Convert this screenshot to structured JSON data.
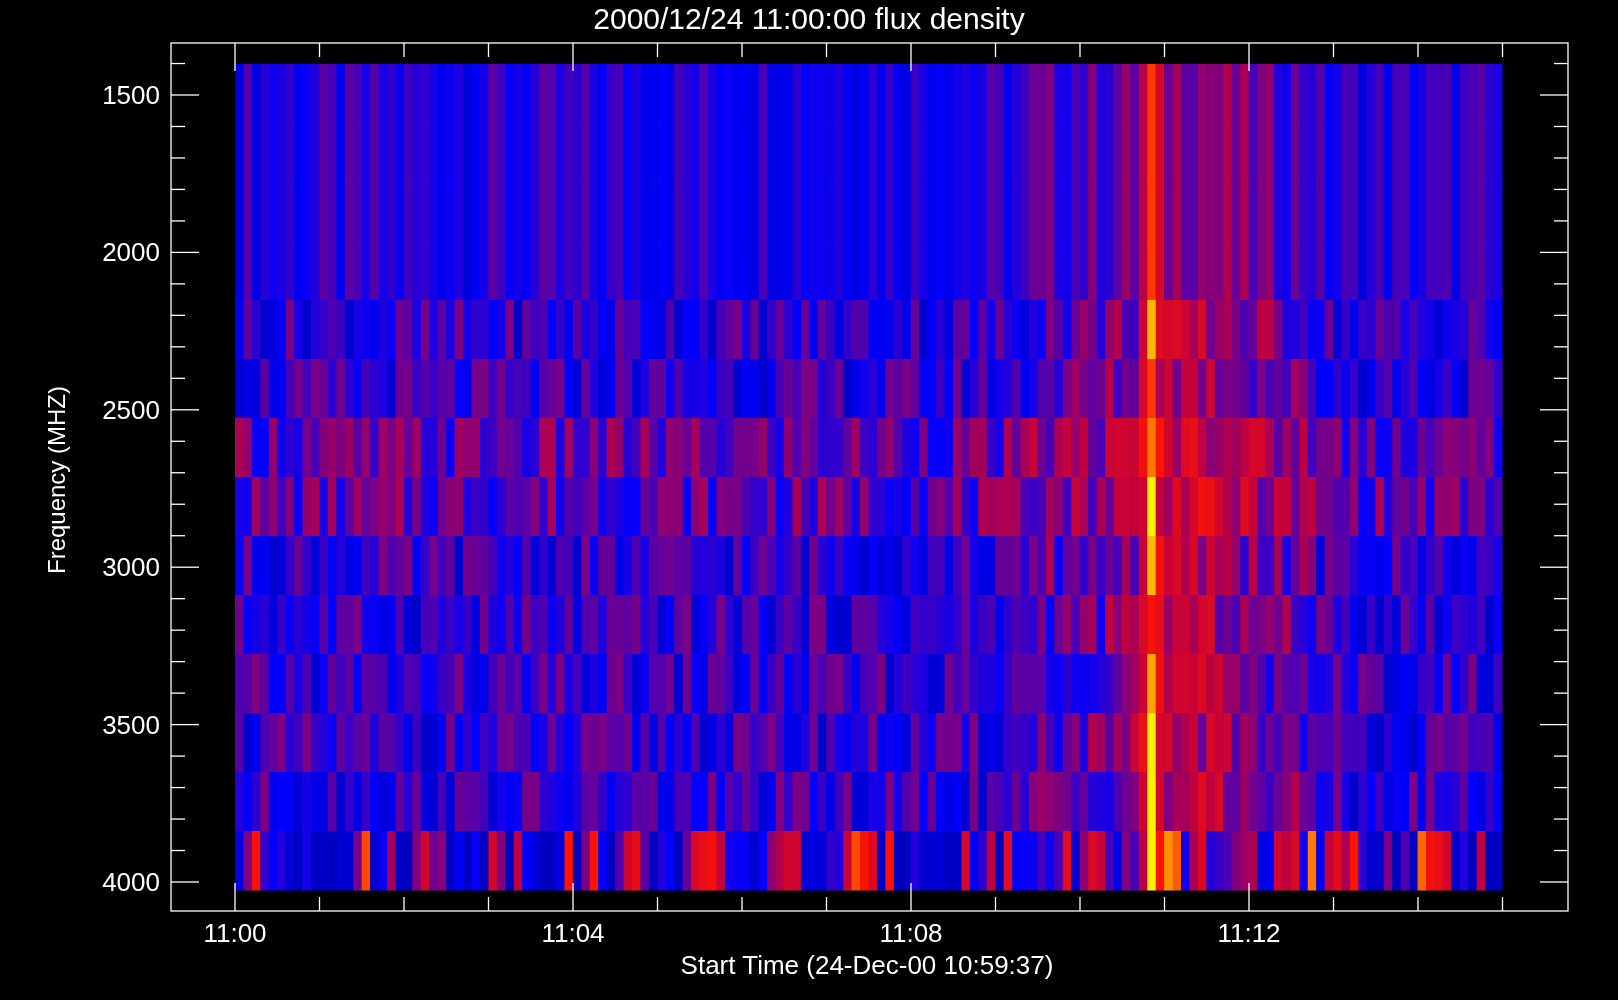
{
  "title": "2000/12/24 11:00:00 flux density",
  "y_axis": {
    "label": "Frequency (MHZ)",
    "ticks": [
      "1500",
      "2000",
      "2500",
      "3000",
      "3500",
      "4000"
    ]
  },
  "x_axis": {
    "label": "Start Time (24-Dec-00 10:59:37)",
    "ticks": [
      "11:00",
      "11:04",
      "11:08",
      "11:12"
    ]
  }
}
